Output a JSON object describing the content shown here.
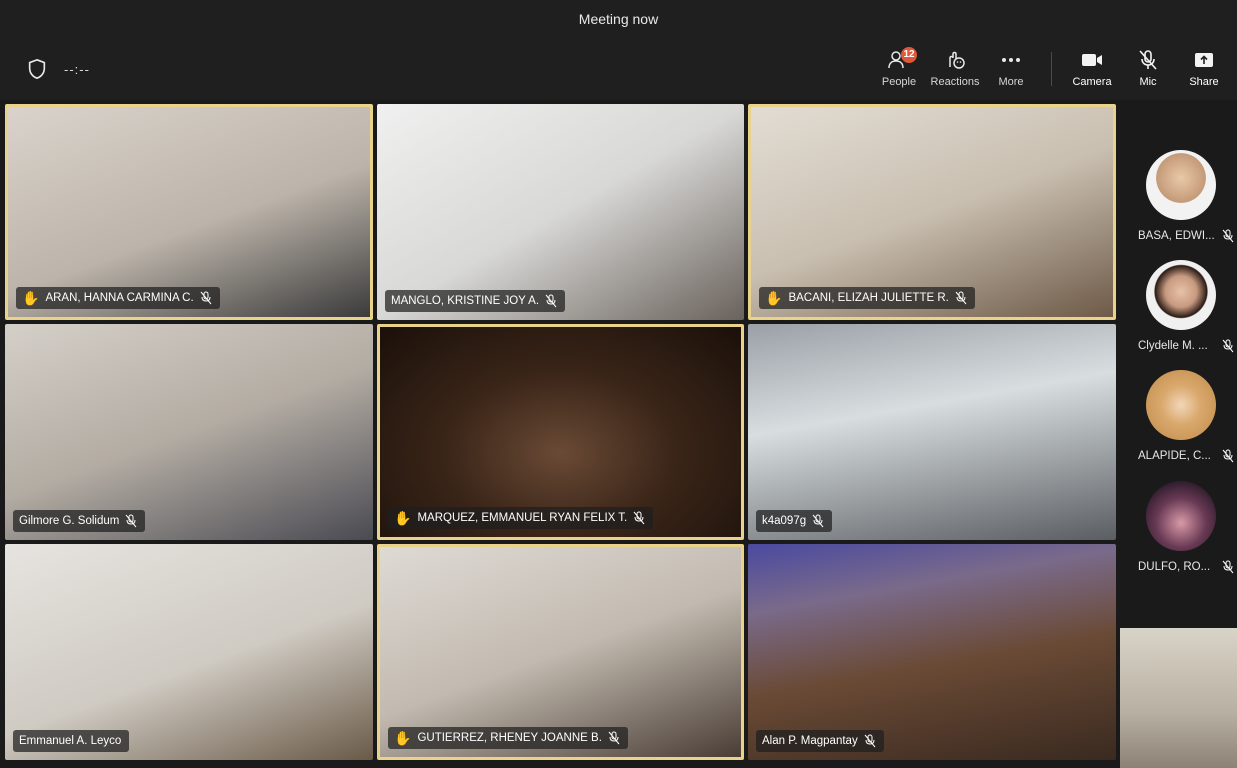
{
  "window": {
    "title": "Meeting now"
  },
  "toolbar": {
    "timer": "--:--",
    "people": {
      "label": "People",
      "count": "12"
    },
    "reactions": {
      "label": "Reactions"
    },
    "more": {
      "label": "More"
    },
    "camera": {
      "label": "Camera"
    },
    "mic": {
      "label": "Mic"
    },
    "share": {
      "label": "Share"
    }
  },
  "tiles": [
    {
      "name": "ARAN, HANNA CARMINA C.",
      "hand": true,
      "muted": true
    },
    {
      "name": "MANGLO, KRISTINE JOY A.",
      "hand": false,
      "muted": true
    },
    {
      "name": "BACANI, ELIZAH JULIETTE R.",
      "hand": true,
      "muted": true
    },
    {
      "name": "Gilmore G. Solidum",
      "hand": false,
      "muted": true
    },
    {
      "name": "MARQUEZ, EMMANUEL RYAN FELIX T.",
      "hand": true,
      "muted": true
    },
    {
      "name": "k4a097g",
      "hand": false,
      "muted": true
    },
    {
      "name": "Emmanuel A. Leyco",
      "hand": false,
      "muted": false
    },
    {
      "name": "GUTIERREZ, RHENEY JOANNE B.",
      "hand": true,
      "muted": true
    },
    {
      "name": "Alan P. Magpantay",
      "hand": false,
      "muted": true
    }
  ],
  "sidebar": [
    {
      "name": "BASA, EDWI..."
    },
    {
      "name": "Clydelle M. ..."
    },
    {
      "name": "ALAPIDE, C..."
    },
    {
      "name": "DULFO, RO..."
    }
  ],
  "colors": {
    "raised_hand_border": "#e9d28a",
    "badge": "#e0583a"
  },
  "icons": {
    "hand": "✋"
  }
}
